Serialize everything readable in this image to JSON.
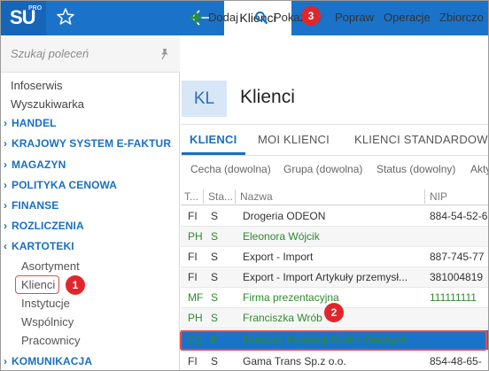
{
  "app": {
    "logo_text": "SU",
    "logo_sup": "PRO",
    "active_tab": "Klienci",
    "brand_color": "#1a73c8"
  },
  "sidebar": {
    "search_placeholder": "Szukaj poleceń",
    "plain_items": [
      "Infoserwis",
      "Wyszukiwarka"
    ],
    "sections": [
      {
        "label": "HANDEL",
        "expanded": false
      },
      {
        "label": "KRAJOWY SYSTEM E-FAKTUR",
        "expanded": false
      },
      {
        "label": "MAGAZYN",
        "expanded": false
      },
      {
        "label": "POLITYKA CENOWA",
        "expanded": false
      },
      {
        "label": "FINANSE",
        "expanded": false
      },
      {
        "label": "ROZLICZENIA",
        "expanded": false
      },
      {
        "label": "KARTOTEKI",
        "expanded": true
      },
      {
        "label": "KOMUNIKACJA",
        "expanded": false
      }
    ],
    "kartoteki_items": [
      "Asortyment",
      "Klienci",
      "Instytucje",
      "Wspólnicy",
      "Pracownicy"
    ],
    "collapsed_caret": "›",
    "expanded_caret": "‹"
  },
  "toolbar": {
    "add_label": "Dodaj",
    "show_label": "Pokaż",
    "edit_label": "Popraw",
    "operations_label": "Operacje",
    "collections_label": "Zbiorczo"
  },
  "page": {
    "badge": "KL",
    "title": "Klienci",
    "tabs": [
      "KLIENCI",
      "MOI KLIENCI",
      "KLIENCI STANDARDOW"
    ],
    "filters": [
      "Cecha (dowolna)",
      "Grupa (dowolna)",
      "Status (dowolny)",
      "Akty"
    ]
  },
  "table": {
    "headers": [
      "T...",
      "Sta...",
      "Nazwa",
      "NIP"
    ],
    "rows": [
      {
        "type": "FI",
        "status": "S",
        "name": "Drogeria ODEON",
        "nip": "884-54-52-6",
        "color": "normal"
      },
      {
        "type": "PH",
        "status": "S",
        "name": "Eleonora Wójcik",
        "nip": "",
        "color": "green"
      },
      {
        "type": "FI",
        "status": "S",
        "name": "Export - Import",
        "nip": "887-745-77",
        "color": "normal"
      },
      {
        "type": "FI",
        "status": "S",
        "name": "Export - Import Artykuły przemysł...",
        "nip": "381004819",
        "color": "normal"
      },
      {
        "type": "MF",
        "status": "S",
        "name": "Firma prezentacyjna",
        "nip": "111111111",
        "color": "green"
      },
      {
        "type": "PH",
        "status": "S",
        "name": "Franciszka Wrób",
        "nip": "",
        "color": "green"
      },
      {
        "type": "FQ",
        "status": "P",
        "name": "Fundusz Promocji Roślin Oleistych",
        "nip": "",
        "color": "selected"
      },
      {
        "type": "FI",
        "status": "S",
        "name": "Gama Trans Sp.z o.o.",
        "nip": "854-48-65-",
        "color": "normal"
      }
    ]
  },
  "annotations": {
    "step1": "1",
    "step2": "2",
    "step3": "3",
    "color": "#e0262c"
  }
}
